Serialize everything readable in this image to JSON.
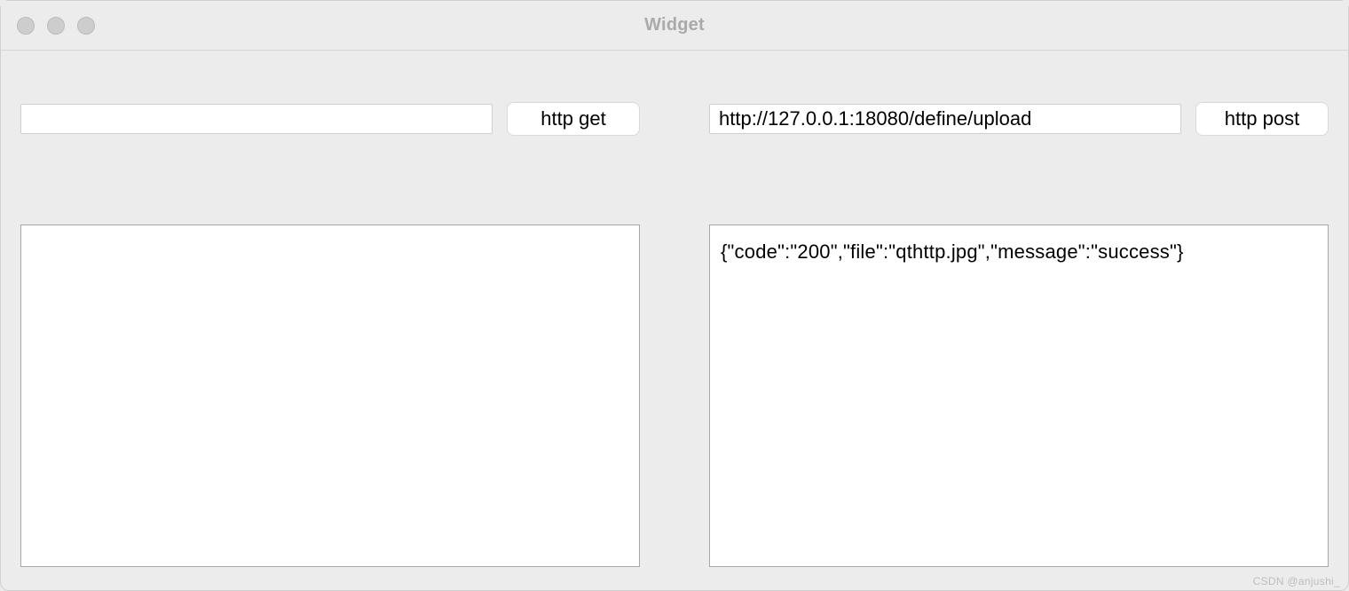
{
  "window": {
    "title": "Widget"
  },
  "left": {
    "url_input": "",
    "get_button": "http get",
    "output": ""
  },
  "right": {
    "url_input": "http://127.0.0.1:18080/define/upload",
    "post_button": "http post",
    "output": "{\"code\":\"200\",\"file\":\"qthttp.jpg\",\"message\":\"success\"}"
  },
  "watermark": "CSDN @anjushi_"
}
